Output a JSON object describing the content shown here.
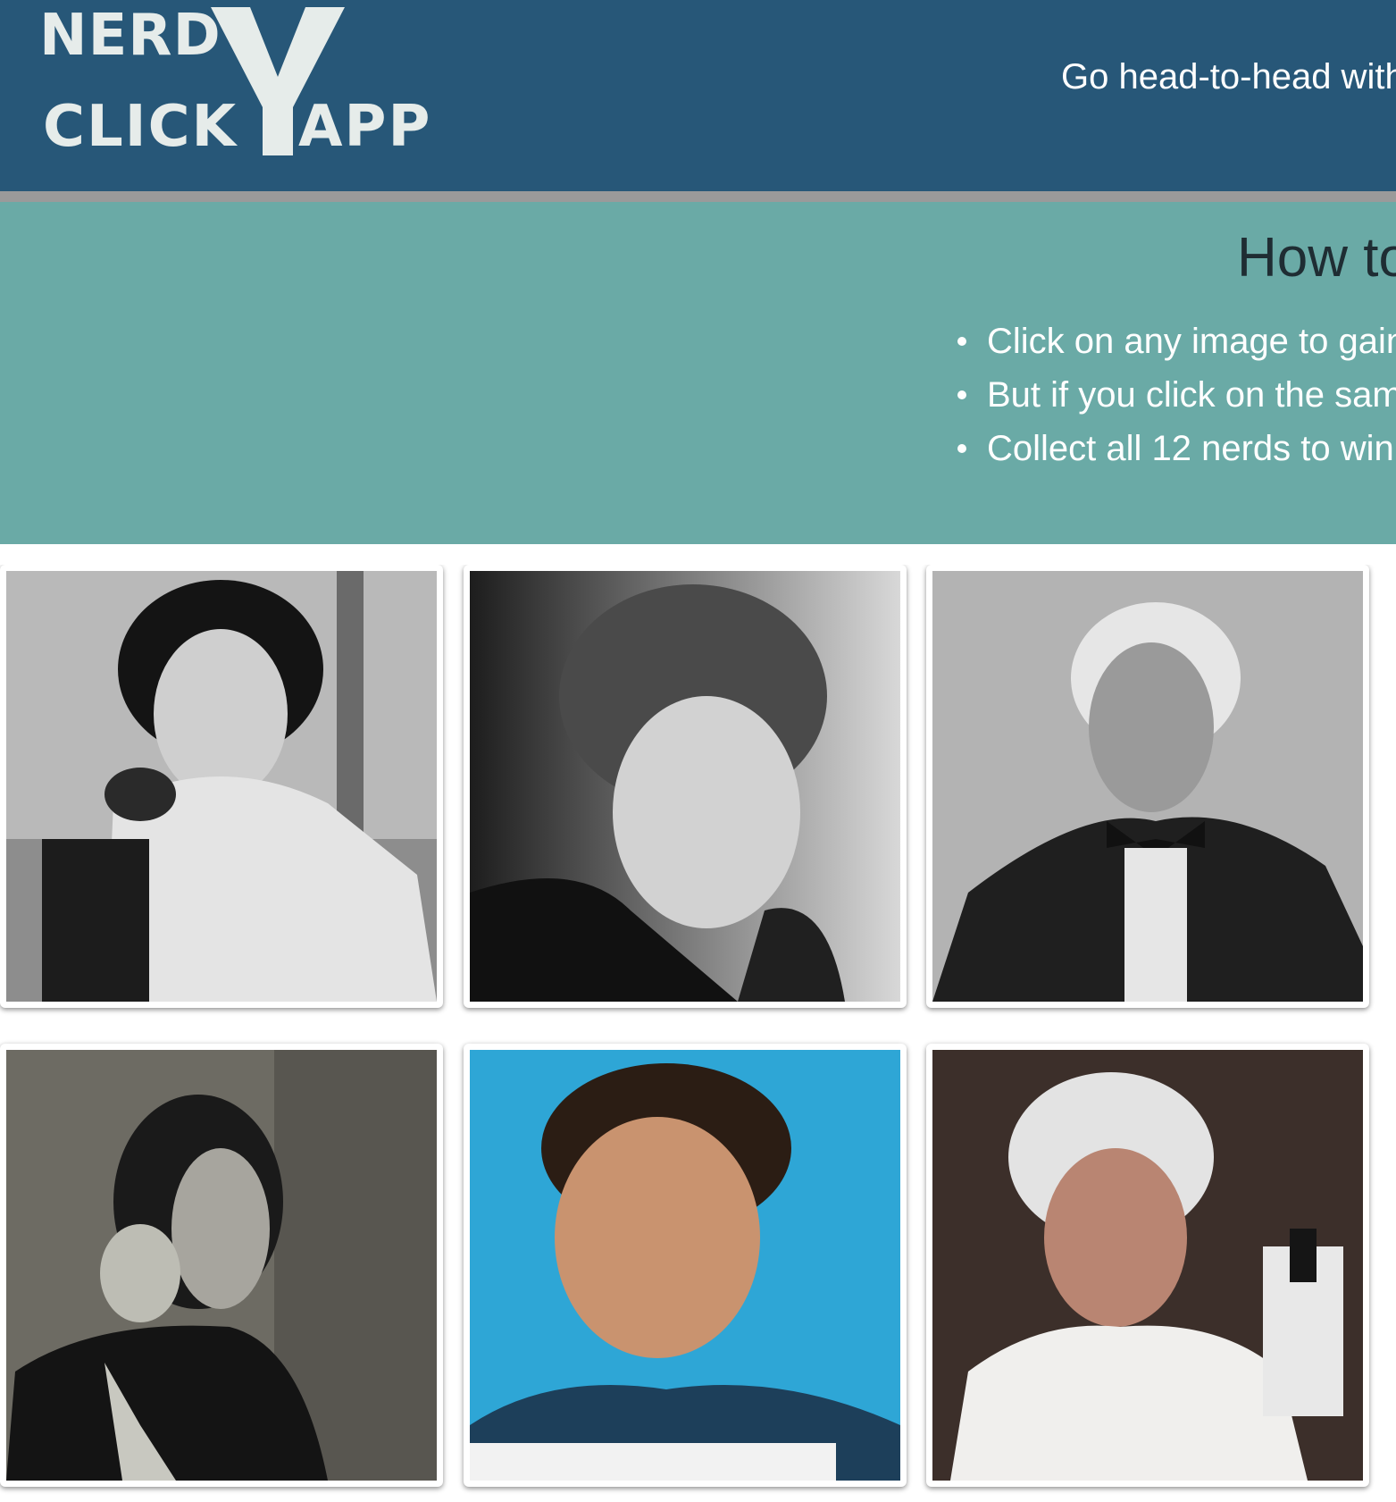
{
  "header": {
    "logo": {
      "line1": "NERD",
      "line2_left": "CLICK",
      "line2_right": "APP",
      "mark_letter": "Y"
    },
    "tagline": "Go head-to-head with",
    "background_color": "#275778",
    "rule_color": "#9a9a9a"
  },
  "instructions": {
    "title": "How to",
    "items": [
      "Click on any image to gain",
      "But if you click on the sam",
      "Collect all 12 nerds to win"
    ],
    "background_color": "#6aaaa6"
  },
  "cards": [
    {
      "id": "nerd-1",
      "icon": "portrait-woman-microscope-icon"
    },
    {
      "id": "nerd-2",
      "icon": "portrait-woman-curly-hair-icon"
    },
    {
      "id": "nerd-3",
      "icon": "portrait-man-bowtie-icon"
    },
    {
      "id": "nerd-4",
      "icon": "portrait-woman-ringlets-icon"
    },
    {
      "id": "nerd-5",
      "icon": "portrait-woman-blue-background-icon"
    },
    {
      "id": "nerd-6",
      "icon": "portrait-elderly-woman-lab-coat-icon"
    }
  ]
}
